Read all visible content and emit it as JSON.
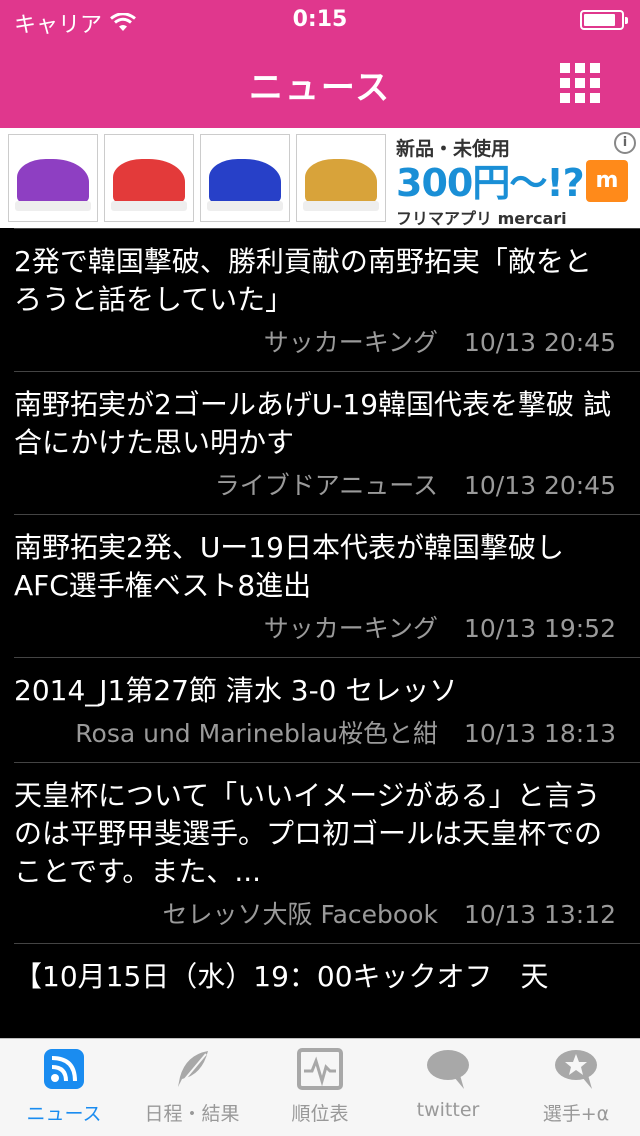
{
  "status_bar": {
    "carrier": "キャリア",
    "time": "0:15",
    "battery_level": 0.85
  },
  "nav": {
    "title": "ニュース",
    "menu_icon": "grid-icon"
  },
  "ad": {
    "line1": "新品・未使用",
    "line2": "300円〜!?",
    "line3": "フリマアプリ mercari",
    "box_letter": "m",
    "info": "i",
    "thumb_colors": [
      "#8e3fc2",
      "#e33a3a",
      "#2740c8",
      "#d8a33a"
    ]
  },
  "news": [
    {
      "title": "2発で韓国撃破、勝利貢献の南野拓実「敵をとろうと話をしていた」",
      "source": "サッカーキング",
      "time": "10/13 20:45"
    },
    {
      "title": "南野拓実が2ゴールあげU-19韓国代表を撃破 試合にかけた思い明かす",
      "source": "ライブドアニュース",
      "time": "10/13 20:45"
    },
    {
      "title": "南野拓実2発、Uー19日本代表が韓国撃破しAFC選手権ベスト8進出",
      "source": "サッカーキング",
      "time": "10/13 19:52"
    },
    {
      "title": "2014_J1第27節 清水 3-0 セレッソ",
      "source": "Rosa und Marineblau桜色と紺",
      "time": "10/13 18:13"
    },
    {
      "title": "天皇杯について「いいイメージがある」と言うのは平野甲斐選手。プロ初ゴールは天皇杯でのことです。また、...",
      "source": "セレッソ大阪 Facebook",
      "time": "10/13 13:12"
    },
    {
      "title": "【10月15日（水）19：00キックオフ　天",
      "source": "",
      "time": ""
    }
  ],
  "tabs": [
    {
      "label": "ニュース",
      "icon": "rss-icon",
      "active": true
    },
    {
      "label": "日程・結果",
      "icon": "feather-icon",
      "active": false
    },
    {
      "label": "順位表",
      "icon": "chart-monitor-icon",
      "active": false
    },
    {
      "label": "twitter",
      "icon": "speech-bubble-icon",
      "active": false
    },
    {
      "label": "選手+α",
      "icon": "star-bubble-icon",
      "active": false
    }
  ],
  "colors": {
    "header": "#e0378d",
    "active_tab": "#1a8cf0",
    "inactive_tab": "#999999"
  }
}
